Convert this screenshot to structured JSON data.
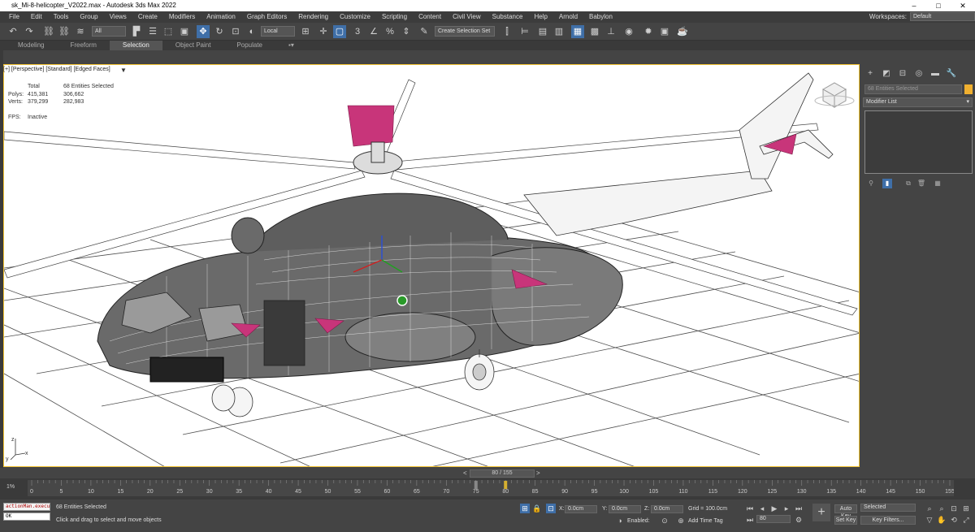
{
  "window": {
    "title": "sk_Mi-8-helicopter_V2022.max - Autodesk 3ds Max 2022",
    "controls": [
      "–",
      "□",
      "✕"
    ]
  },
  "menu": {
    "items": [
      "File",
      "Edit",
      "Tools",
      "Group",
      "Views",
      "Create",
      "Modifiers",
      "Animation",
      "Graph Editors",
      "Rendering",
      "Customize",
      "Scripting",
      "Content",
      "Civil View",
      "Substance",
      "Help",
      "Arnold",
      "Babylon"
    ],
    "workspaces_label": "Workspaces:",
    "workspaces_value": "Default"
  },
  "toolbar": {
    "filter_value": "All",
    "ref_coord_value": "Local",
    "selection_set_placeholder": "Create Selection Set"
  },
  "ribbon": {
    "tabs": [
      "Modeling",
      "Freeform",
      "Selection",
      "Object Paint",
      "Populate"
    ],
    "active_tab": "Selection"
  },
  "viewport": {
    "label": "[+] [Perspective] [Standard] [Edged Faces]",
    "stats": {
      "header_total": "Total",
      "header_selected": "68 Entities Selected",
      "polys_label": "Polys:",
      "polys_total": "415,381",
      "polys_selected": "306,662",
      "verts_label": "Verts:",
      "verts_total": "379,299",
      "verts_selected": "282,983",
      "fps_label": "FPS:",
      "fps_value": "Inactive"
    },
    "axis_labels": {
      "x": "x",
      "y": "y",
      "z": "z"
    }
  },
  "command_panel": {
    "name_field": "68 Entities Selected",
    "modifier_list": "Modifier List"
  },
  "timeline": {
    "current_frame": "80 / 155",
    "ticks": [
      "0",
      "5",
      "10",
      "15",
      "20",
      "25",
      "30",
      "35",
      "40",
      "45",
      "50",
      "55",
      "60",
      "65",
      "70",
      "75",
      "80",
      "85",
      "90",
      "95",
      "100",
      "105",
      "110",
      "115",
      "120",
      "125",
      "130",
      "135",
      "140",
      "145",
      "150",
      "155"
    ],
    "marker_frames": [
      75,
      80
    ],
    "left_toggle": "1%"
  },
  "status": {
    "maxscript_text": "actionMan.execu",
    "maxscript_result": "OK",
    "selection_text": "68 Entities Selected",
    "prompt_text": "Click and drag to select and move objects",
    "x_label": "X:",
    "x_value": "0.0cm",
    "y_label": "Y:",
    "y_value": "0.0cm",
    "z_label": "Z:",
    "z_value": "0.0cm",
    "grid": "Grid = 100.0cm",
    "enabled_label": "Enabled:",
    "add_time_tag": "Add Time Tag",
    "frame_field": "80",
    "auto_key": "Auto Key",
    "set_key": "Set Key",
    "selected_value": "Selected",
    "key_filters": "Key Filters..."
  },
  "colors": {
    "selection_bright": "#ffffff",
    "accent_pink": "#c8357a",
    "viewport_border": "#f2c232",
    "active_button": "#3f6fa8"
  }
}
